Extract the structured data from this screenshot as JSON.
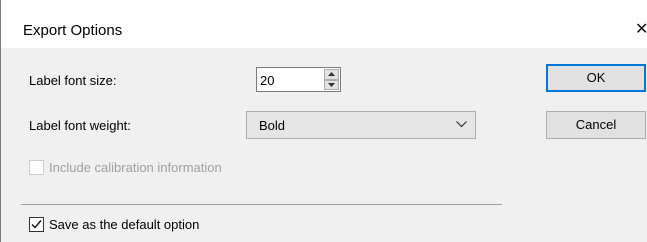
{
  "window": {
    "title": "Export Options"
  },
  "fields": {
    "label_font_size": {
      "label": "Label font size:",
      "value": "20"
    },
    "label_font_weight": {
      "label": "Label font weight:",
      "value": "Bold"
    },
    "include_calibration": {
      "label": "Include calibration information",
      "checked": false,
      "enabled": false
    },
    "save_default": {
      "label": "Save as the default option",
      "checked": true,
      "enabled": true
    }
  },
  "buttons": {
    "ok": "OK",
    "cancel": "Cancel"
  },
  "icons": {
    "close": "close-icon",
    "spin_up": "triangle-up-icon",
    "spin_down": "triangle-down-icon",
    "dropdown": "chevron-down-icon",
    "check": "checkmark-icon"
  },
  "colors": {
    "accent": "#0078d7",
    "disabled_text": "#a0a0a0"
  }
}
